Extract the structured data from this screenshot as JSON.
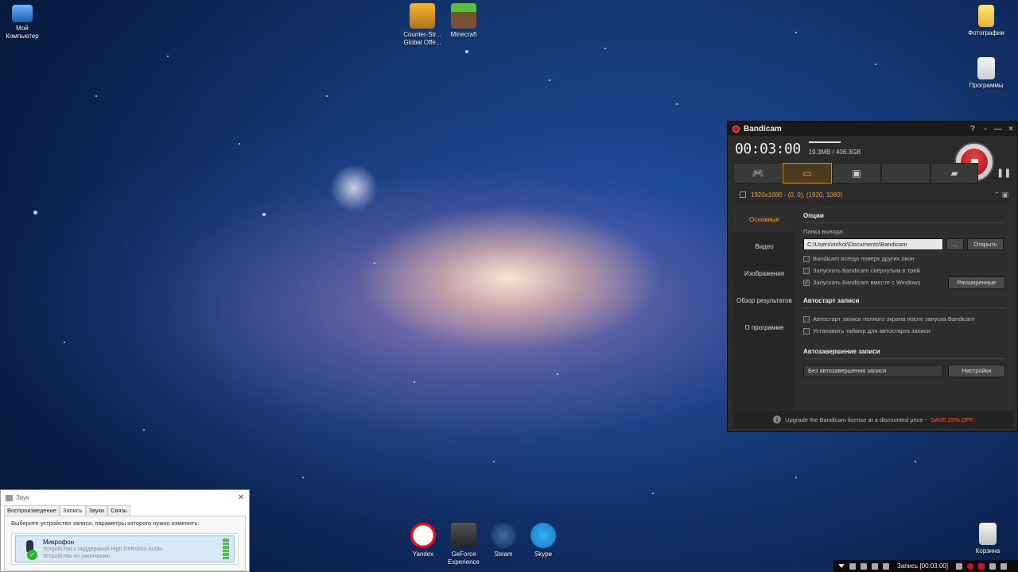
{
  "desktop": {
    "icons": {
      "my_computer": "Мой Компьютер",
      "csgo": "Counter-Str... Global Offe...",
      "minecraft": "Minecraft",
      "photos": "Фотографии",
      "programs": "Программы",
      "yandex": "Yandex",
      "geforce": "GeForce Experience",
      "steam": "Steam",
      "skype": "Skype",
      "recycle": "Корзина"
    }
  },
  "bandicam": {
    "title": "Bandicam",
    "help": "?",
    "minimize": "-",
    "restore": "—",
    "close": "×",
    "timer": "00:03:00",
    "size": "19.3MB / 406.3GB",
    "resolution": "1920x1080 - (0, 0), (1920, 1080)",
    "nav": [
      "Основные",
      "Видео",
      "Изображения",
      "Обзор результатов",
      "О программе"
    ],
    "options": {
      "heading": "Опции",
      "folder_label": "Папка вывода:",
      "folder_value": "C:\\Users\\mrkot\\Documents\\Bandicam",
      "browse": "...",
      "open": "Открыть",
      "cb_on_top": "Bandicam всегда поверх других окон",
      "cb_tray": "Запускать Bandicam свёрнутым в трей",
      "cb_startup": "Запускать Bandicam вместе с Windows",
      "cb_startup_mark": "✓",
      "advanced": "Расширенные"
    },
    "autostart": {
      "heading": "Автостарт записи",
      "cb_fullscreen": "Автостарт записи полного экрана после запуска Bandicam",
      "cb_timer": "Установить таймер для автостарта записи"
    },
    "autostop": {
      "heading": "Автозавершение записи",
      "value": "Без автозавершения записи",
      "settings": "Настройки"
    },
    "footer": {
      "info": "i",
      "text": "Upgrade the Bandicam license at a discounted price - ",
      "promo": "SAVE 25% OFF"
    }
  },
  "sound": {
    "title": "Звук",
    "close": "✕",
    "tabs": [
      "Воспроизведение",
      "Запись",
      "Звуки",
      "Связь"
    ],
    "active_tab": 1,
    "prompt": "Выберите устройство записи, параметры которого нужно изменить:",
    "device": {
      "name": "Микрофон",
      "desc": "Устройство с поддержкой High Definition Audio",
      "status": "Устройство по умолчанию",
      "check": "✓"
    }
  },
  "tray": {
    "recording": "Запись [00:03:00]"
  },
  "colors": {
    "accent": "#f0a030",
    "record": "#c8101b",
    "promo": "#f05a28"
  }
}
